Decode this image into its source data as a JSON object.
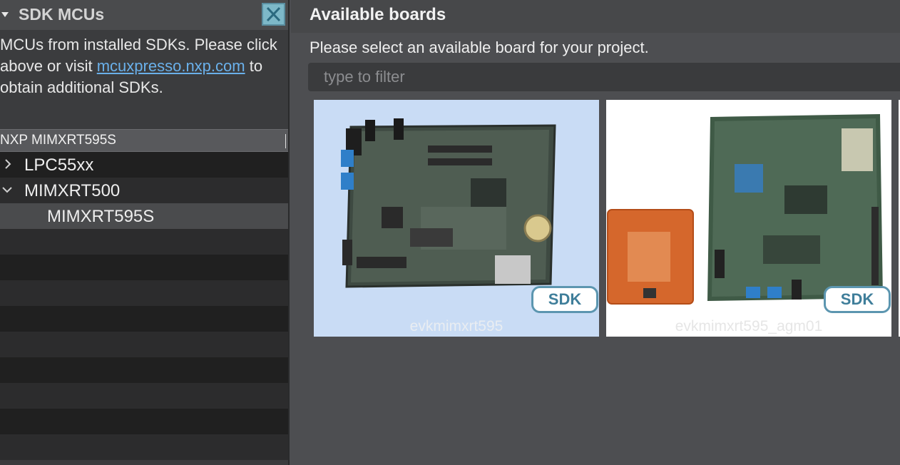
{
  "sdk_panel": {
    "title": "SDK MCUs",
    "description_part1": "MCUs from installed SDKs. Please click above or visit ",
    "link_text": "mcuxpresso.nxp.com",
    "description_part2": " to obtain additional SDKs.",
    "filter_value": "NXP MIMXRT595S",
    "tree": [
      {
        "label": "LPC55xx",
        "expanded": false
      },
      {
        "label": "MIMXRT500",
        "expanded": true
      },
      {
        "label": "MIMXRT595S",
        "selected": true
      }
    ]
  },
  "boards_panel": {
    "title": "Available boards",
    "subtitle": "Please select an available board for your project.",
    "filter_placeholder": "type to filter",
    "boards": [
      {
        "name": "evkmimxrt595",
        "badge": "SDK",
        "selected": true
      },
      {
        "name": "evkmimxrt595_agm01",
        "badge": "SDK",
        "selected": false
      }
    ]
  },
  "colors": {
    "link": "#6ab0ea",
    "selected_card": "#c9dcf5",
    "badge_border": "#5c96b0"
  }
}
